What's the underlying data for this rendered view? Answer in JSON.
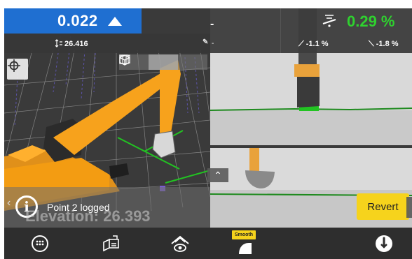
{
  "top_panel": {
    "grade_value": "0.022",
    "elevation_reading": "26.416",
    "right_dash": "-",
    "left_edge_dash": "-"
  },
  "cross_slope": {
    "percent": "0.29 %",
    "left_slope": "-1.1 %",
    "right_slope": "-1.8 %"
  },
  "notification": {
    "message": "Point 2 logged",
    "overlay_text": "Elevation: 26.393"
  },
  "buttons": {
    "revert_label": "Revert",
    "smooth_label": "Smooth"
  },
  "colors": {
    "accent_blue": "#1f6fd1",
    "slope_green": "#2fd12f",
    "action_yellow": "#f6d31c",
    "machine_orange": "#f39c12",
    "design_line_green": "#22c322"
  },
  "icons": {
    "elevation": "elevation-icon",
    "cross_slope": "cross-slope-icon",
    "target": "crosshair-icon",
    "view_plan": "plan-view-icon",
    "view_3d": "cube-icon",
    "view_profile": "profile-view-icon",
    "menu": "menu-icon",
    "design": "design-icon",
    "machine_view": "machine-view-icon",
    "bucket": "bucket-icon",
    "alert": "alert-icon"
  }
}
